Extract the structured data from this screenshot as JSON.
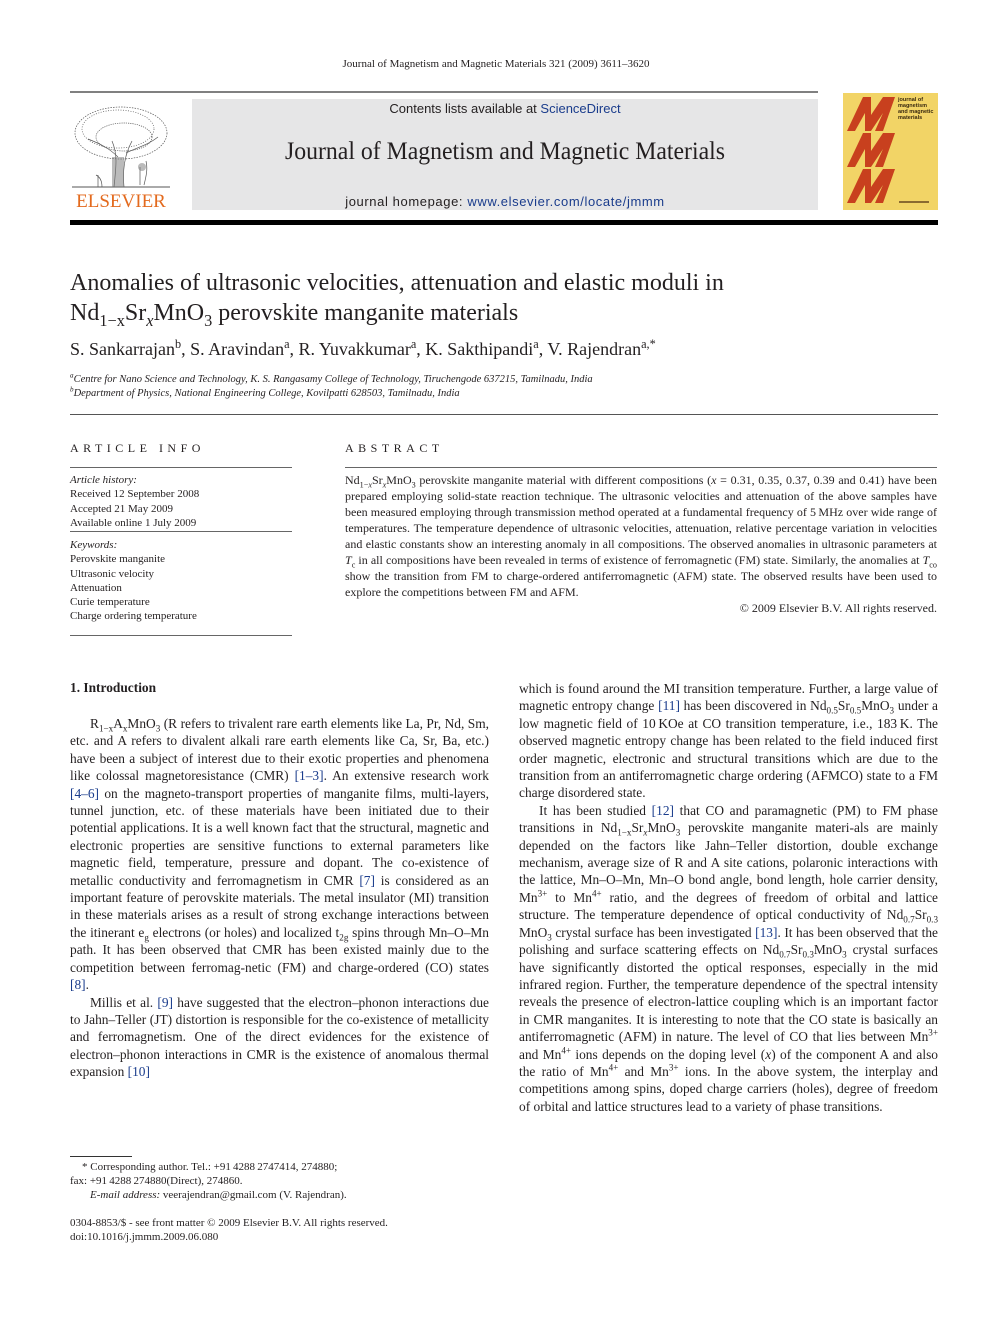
{
  "running_head": "Journal of Magnetism and Magnetic Materials 321 (2009) 3611–3620",
  "masthead": {
    "contents_prefix": "Contents lists available at ",
    "contents_link": "ScienceDirect",
    "journal_title": "Journal of Magnetism and Magnetic Materials",
    "homepage_prefix": "journal homepage: ",
    "homepage_link": "www.elsevier.com/locate/jmmm",
    "publisher_logo_text": "ELSEVIER",
    "cover_text": "journal of magnetism and magnetic materials",
    "colors": {
      "elsevier_orange": "#e36a1e",
      "link_blue": "#1a3c8c",
      "cover_yellow": "#f2d466",
      "cover_red": "#c8401e",
      "masthead_gray": "#e6e6e7"
    }
  },
  "article": {
    "title_line1": "Anomalies of ultrasonic velocities, attenuation and elastic moduli in",
    "title_line2_formula": {
      "base1": "Nd",
      "sub1": "1−x",
      "base2": "Sr",
      "sub2": "x",
      "base3": "MnO",
      "sub3": "3"
    },
    "title_line2_rest": " perovskite manganite materials",
    "authors": [
      {
        "name": "S. Sankarrajan",
        "aff": "b"
      },
      {
        "name": "S. Aravindan",
        "aff": "a"
      },
      {
        "name": "R. Yuvakkumar",
        "aff": "a"
      },
      {
        "name": "K. Sakthipandi",
        "aff": "a"
      },
      {
        "name": "V. Rajendran",
        "aff": "a,*"
      }
    ],
    "affiliations": [
      {
        "mark": "a",
        "text": "Centre for Nano Science and Technology, K. S. Rangasamy College of Technology, Tiruchengode 637215, Tamilnadu, India"
      },
      {
        "mark": "b",
        "text": "Department of Physics, National Engineering College, Kovilpatti 628503, Tamilnadu, India"
      }
    ]
  },
  "article_info": {
    "heading": "ARTICLE INFO",
    "history_label": "Article history:",
    "history": [
      "Received 12 September 2008",
      "Accepted 21 May 2009",
      "Available online 1 July 2009"
    ],
    "keywords_label": "Keywords:",
    "keywords": [
      "Perovskite manganite",
      "Ultrasonic velocity",
      "Attenuation",
      "Curie temperature",
      "Charge ordering temperature"
    ]
  },
  "abstract": {
    "heading": "ABSTRACT",
    "p1_a": " perovskite manganite material with different compositions (",
    "x_var": "x",
    "p1_b": " = 0.31, 0.35, 0.37, 0.39 and 0.41) have been prepared employing solid-state reaction technique. The ultrasonic velocities and attenuation of the above samples have been measured employing through transmission method operated at a fundamental frequency of 5 MHz over wide range of temperatures. The temperature dependence of ultrasonic velocities, attenuation, relative percentage variation in velocities and elastic constants show an interesting anomaly in all compositions. The observed anomalies in ultrasonic parameters at ",
    "tc": "T",
    "tc_sub": "c",
    "p1_c": " in all compositions have been revealed in terms of existence of ferromagnetic (FM) state. Similarly, the anomalies at ",
    "tco": "T",
    "tco_sub": "co",
    "p1_d": " show the transition from FM to charge-ordered antiferromagnetic (AFM) state. The observed results have been used to explore the competitions between FM and AFM.",
    "copyright": "© 2009 Elsevier B.V. All rights reserved."
  },
  "body": {
    "section_heading": "1.  Introduction",
    "left_col": {
      "p1_formula": {
        "b1": "R",
        "s1": "1−x",
        "b2": "A",
        "s2": "x",
        "b3": "MnO",
        "s3": "3"
      },
      "p1_a": " (R refers to trivalent rare earth elements like La, Pr, Nd, Sm, etc. and A refers to divalent alkali rare earth elements like Ca, Sr, Ba, etc.) have been a subject of interest due to their exotic properties and phenomena like colossal magnetoresistance (CMR) ",
      "cite1": "[1–3]",
      "p1_b": ". An extensive research work ",
      "cite2": "[4–6]",
      "p1_c": " on the magneto-transport properties of manganite films, multi-layers, tunnel junction, etc. of these materials have been initiated due to their potential applications. It is a well known fact that the structural, magnetic and electronic properties are sensitive functions to external parameters like magnetic field, temperature, pressure and dopant. The co-existence of metallic conductivity and ferromagnetism in CMR ",
      "cite3": "[7]",
      "p1_d": " is considered as an important feature of perovskite materials. The metal insulator (MI) transition in these materials arises as a result of strong exchange interactions between the itinerant e",
      "eg_sub": "g",
      "p1_e": " electrons (or holes) and localized t",
      "t2g_sub": "2g",
      "p1_f": " spins through Mn–O–Mn path. It has been observed that CMR has been existed mainly due to the competition between ferromag-netic (FM) and charge-ordered (CO) states ",
      "cite4": "[8]",
      "p1_g": ".",
      "p2_a": "Millis et al. ",
      "cite5": "[9]",
      "p2_b": " have suggested that the electron–phonon interactions due to Jahn–Teller (JT) distortion is responsible for the co-existence of metallicity and ferromagnetism. One of the direct evidences for the existence of electron–phonon interactions in CMR is the existence of anomalous thermal expansion ",
      "cite6": "[10]"
    },
    "right_col": {
      "p1_a": "which is found around the MI transition temperature. Further, a large value of magnetic entropy change ",
      "cite1": "[11]",
      "p1_b": " has been discovered in Nd",
      "nd_sub": "0.5",
      "sr": "Sr",
      "sr_sub": "0.5",
      "mno": "MnO",
      "mno_sub": "3",
      "p1_c": " under a low magnetic field of 10 KOe at CO transition temperature, i.e., 183 K. The observed magnetic entropy change has been related to the field induced first order magnetic, electronic and structural transitions which are due to the transition from an antiferromagnetic charge ordering (AFMCO) state to a FM charge disordered state.",
      "p2_a": "It has been studied ",
      "cite2": "[12]",
      "p2_b": " that CO and paramagnetic (PM) to FM phase transitions in Nd",
      "p2_nd_sub": "1−x",
      "p2_sr_sub": "x",
      "p2_c": " perovskite manganite materi-als are mainly depended on the factors like Jahn–Teller distortion, double exchange mechanism, average size of R and A site cations, polaronic interactions with the lattice, Mn–O–Mn, Mn–O bond angle, bond length, hole carrier density, Mn",
      "mn3": "3+",
      "p2_d": " to Mn",
      "mn4": "4+",
      "p2_e": " ratio, and the degrees of freedom of orbital and lattice structure. The temperature dependence of optical conductivity of Nd",
      "nd07": "0.7",
      "sr03": "0.3",
      "p2_f": " crystal surface has been investigated ",
      "cite3": "[13]",
      "p2_g": ". It has been observed that the polishing and surface scattering effects on Nd",
      "p2_h": " crystal surfaces have significantly distorted the optical responses, especially in the mid infrared region. Further, the temperature dependence of the spectral intensity reveals the presence of electron-lattice coupling which is an important factor in CMR manganites. It is interesting to note that the CO state is basically an antiferromagnetic (AFM) in nature. The level of CO that lies between Mn",
      "p2_i": " and Mn",
      "p2_j": " ions depends on the doping level (",
      "p2_k": ") of the component A and also the ratio of Mn",
      "p2_l": " and Mn",
      "p2_m": " ions. In the above system, the interplay and competitions among spins, doped charge carriers (holes), degree of freedom of orbital and lattice structures lead to a variety of phase transitions."
    }
  },
  "footnotes": {
    "corresponding": "* Corresponding author. Tel.: +91 4288 2747414, 274880;",
    "fax": "fax: +91 4288 274880(Direct), 274860.",
    "email_label": "E-mail address:",
    "email": " veerajendran@gmail.com (V. Rajendran).",
    "issn": "0304-8853/$ - see front matter © 2009 Elsevier B.V. All rights reserved.",
    "doi": "doi:10.1016/j.jmmm.2009.06.080"
  }
}
